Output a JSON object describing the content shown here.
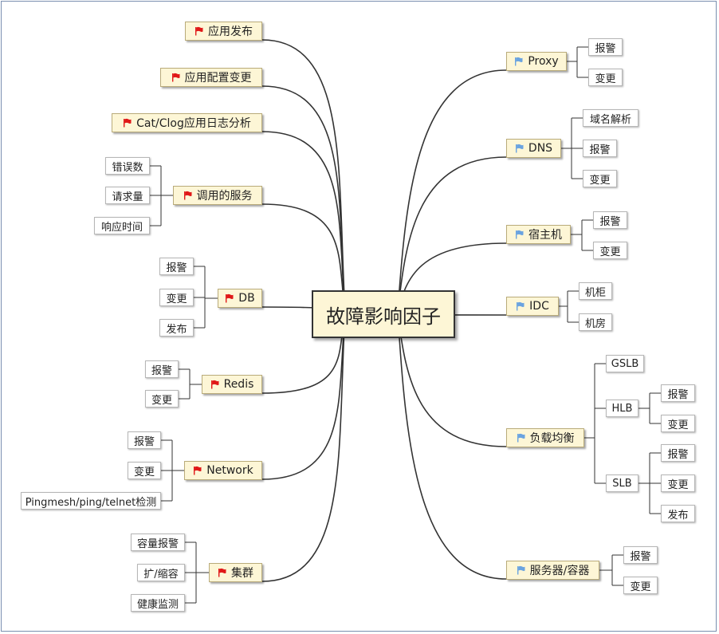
{
  "center": "故障影响因子",
  "colors": {
    "left_flag": "#e01818",
    "right_flag": "#6aa3e0",
    "line": "#333333"
  },
  "left_branches": [
    {
      "id": "app-release",
      "label": "应用发布",
      "flag": "red-flag-icon",
      "children": []
    },
    {
      "id": "app-config",
      "label": "应用配置变更",
      "flag": "red-flag-icon",
      "children": []
    },
    {
      "id": "cat-clog",
      "label": "Cat/Clog应用日志分析",
      "flag": "red-flag-icon",
      "children": []
    },
    {
      "id": "called-service",
      "label": "调用的服务",
      "flag": "red-flag-icon",
      "children": [
        "错误数",
        "请求量",
        "响应时间"
      ]
    },
    {
      "id": "db",
      "label": "DB",
      "flag": "red-flag-icon",
      "children": [
        "报警",
        "变更",
        "发布"
      ]
    },
    {
      "id": "redis",
      "label": "Redis",
      "flag": "red-flag-icon",
      "children": [
        "报警",
        "变更"
      ]
    },
    {
      "id": "network",
      "label": "Network",
      "flag": "red-flag-icon",
      "children": [
        "报警",
        "变更",
        "Pingmesh/ping/telnet检测"
      ]
    },
    {
      "id": "cluster",
      "label": "集群",
      "flag": "red-flag-icon",
      "children": [
        "容量报警",
        "扩/缩容",
        "健康监测"
      ]
    }
  ],
  "right_branches": [
    {
      "id": "proxy",
      "label": "Proxy",
      "flag": "blue-flag-icon",
      "children": [
        "报警",
        "变更"
      ]
    },
    {
      "id": "dns",
      "label": "DNS",
      "flag": "blue-flag-icon",
      "children": [
        "域名解析",
        "报警",
        "变更"
      ]
    },
    {
      "id": "host",
      "label": "宿主机",
      "flag": "blue-flag-icon",
      "children": [
        "报警",
        "变更"
      ]
    },
    {
      "id": "idc",
      "label": "IDC",
      "flag": "blue-flag-icon",
      "children": [
        "机柜",
        "机房"
      ]
    },
    {
      "id": "lb",
      "label": "负载均衡",
      "flag": "blue-flag-icon",
      "children": [
        {
          "label": "GSLB",
          "children": []
        },
        {
          "label": "HLB",
          "children": [
            "报警",
            "变更"
          ]
        },
        {
          "label": "SLB",
          "children": [
            "报警",
            "变更",
            "发布"
          ]
        }
      ]
    },
    {
      "id": "server",
      "label": "服务器/容器",
      "flag": "blue-flag-icon",
      "children": [
        "报警",
        "变更"
      ]
    }
  ]
}
